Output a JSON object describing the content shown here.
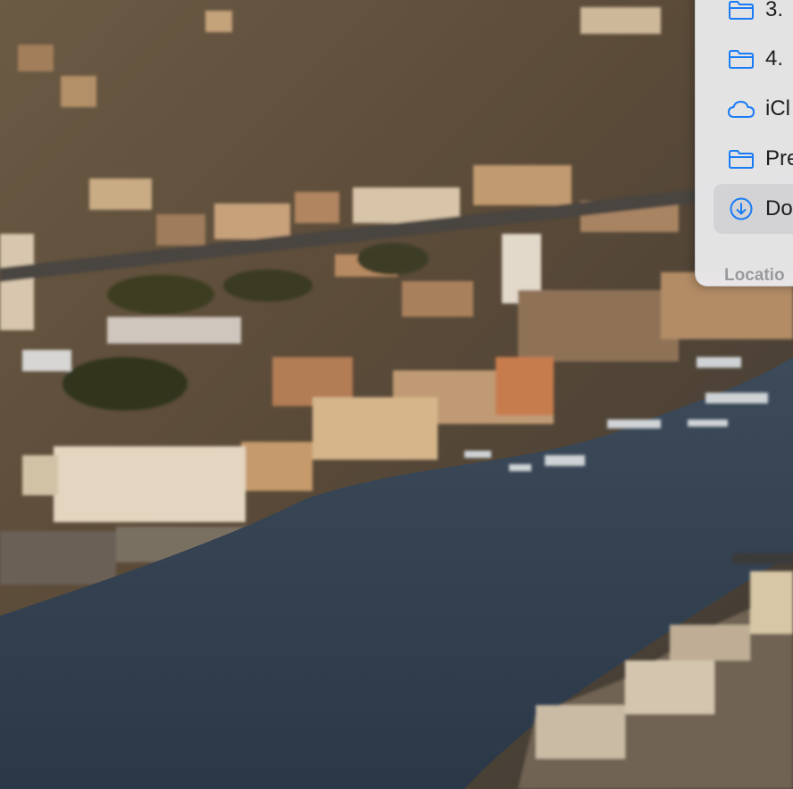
{
  "sidebar": {
    "items": [
      {
        "label": "3.",
        "icon": "folder-icon"
      },
      {
        "label": "4.",
        "icon": "folder-icon"
      },
      {
        "label": "iCl",
        "icon": "icloud-icon"
      },
      {
        "label": "Pre",
        "icon": "folder-icon"
      },
      {
        "label": "Do",
        "icon": "download-icon",
        "selected": true
      }
    ],
    "locations_header": "Locatio"
  },
  "colors": {
    "accent": "#1a7cf5",
    "sidebar_bg": "#e8e8ea",
    "selection": "#d3d3d6"
  }
}
